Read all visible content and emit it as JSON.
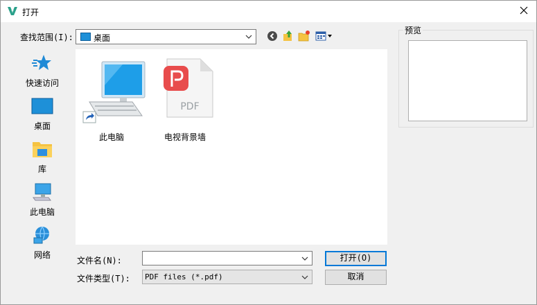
{
  "window": {
    "title": "打开",
    "close_icon": "close-icon",
    "app_icon": "wps-logo-icon",
    "accent": "#0078d7"
  },
  "lookin": {
    "label": "查找范围(I):",
    "value": "桌面",
    "toolbar": [
      "back-icon",
      "up-folder-icon",
      "new-folder-icon",
      "view-menu-icon"
    ]
  },
  "places": [
    {
      "label": "快速访问",
      "icon": "star-icon"
    },
    {
      "label": "桌面",
      "icon": "desktop-icon"
    },
    {
      "label": "库",
      "icon": "library-folder-icon"
    },
    {
      "label": "此电脑",
      "icon": "computer-icon"
    },
    {
      "label": "网络",
      "icon": "network-icon"
    }
  ],
  "files": [
    {
      "name": "此电脑",
      "icon": "computer-shortcut-icon"
    },
    {
      "name": "电视背景墙",
      "icon": "pdf-file-icon",
      "badge": "PDF",
      "badge_color": "#e84c4c"
    }
  ],
  "preview": {
    "label": "预览"
  },
  "filename": {
    "label": "文件名(N):",
    "value": ""
  },
  "filetype": {
    "label": "文件类型(T):",
    "value": "PDF files (*.pdf)"
  },
  "buttons": {
    "open": "打开(O)",
    "cancel": "取消"
  }
}
